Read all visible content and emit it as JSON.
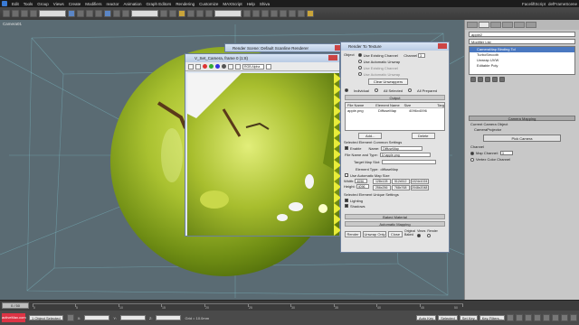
{
  "app": {
    "menu": [
      "Edit",
      "Tools",
      "Group",
      "Views",
      "Create",
      "Modifiers",
      "reactor",
      "Animation",
      "Graph Editors",
      "Rendering",
      "Customize",
      "MAXScript",
      "Help",
      "Shiva"
    ],
    "title_right": [
      "FaceliftScript",
      "defFrameScene"
    ]
  },
  "toolbar": {
    "selection_filter": "All",
    "view_dropdown": "View"
  },
  "viewport": {
    "label": "Camera01"
  },
  "command_panel": {
    "object_name": "apple2",
    "modifier_list": "Modifier List",
    "stack": [
      "CameraMap Binding Tol",
      "TurboSmooth",
      "Unwrap UVW",
      "Editable Poly"
    ],
    "selected_stack_index": 0,
    "rollout_camera_mapping": "Camera Mapping",
    "current_camera_object_label": "Current Camera Object",
    "current_camera_value": "CameraProjector",
    "pick_camera_button": "Pick Camera",
    "channel_group": "Channel",
    "map_channel_label": "Map Channel:",
    "map_channel_value": "3",
    "vertex_color_channel_label": "Vertex Color Channel"
  },
  "render_scene": {
    "title": "Render Scene: Default Scanline Renderer"
  },
  "frame_buffer": {
    "title": "V_Set_Camera, frame 0 (1:8)",
    "channel_select": "RGB Alpha",
    "swatch_colors": [
      "#d33",
      "#3a3",
      "#33d",
      "#555",
      "#ddd",
      "#fff"
    ]
  },
  "rtt": {
    "title": "Render To Texture",
    "object_label": "Object",
    "mapping_coords": [
      "Use Existing Channel",
      "Use Automatic Unwrap"
    ],
    "sub_objects": [
      "Use Existing Channel",
      "Use Automatic Unwrap"
    ],
    "channel_label": "Channel",
    "channel_value": "3",
    "clear_unwrappers": "Clear Unwrappers",
    "individual": "Individual",
    "all_selected": "All Selected",
    "all_prepared": "All Prepared",
    "output_section": "Output",
    "table_headers": [
      "File Name",
      "Element Name",
      "Size",
      "Targ"
    ],
    "table_rows": [
      [
        "apple.png",
        "DiffuseMap",
        "4096x4096",
        ""
      ]
    ],
    "add_button": "Add...",
    "delete_button": "Delete",
    "element_settings": "Selected Element Common Settings",
    "enable_label": "Enable",
    "name_label": "Name:",
    "name_value": "DiffuseMap",
    "file_name_label": "File Name and Type:",
    "file_name_value": "D:\\apple.png",
    "target_map_slot": "Target Map Slot:",
    "element_type_label": "Element Type:",
    "element_type_value": "diffuseMap",
    "auto_map_size": "Use Automatic Map Size",
    "width_label": "Width:",
    "width_value": "4096",
    "height_label": "Height:",
    "height_value": "4096",
    "sizes": [
      "128x128",
      "512x512",
      "1024x1024",
      "256x256",
      "768x768",
      "2048x2048"
    ],
    "unique_settings": "Selected Element Unique Settings",
    "lighting": "Lighting",
    "shadows": "Shadows",
    "baked_material": "Baked Material",
    "automatic_mapping": "Automatic Mapping",
    "render_button": "Render",
    "unwrap_only": "Unwrap Only",
    "close_button": "Close",
    "original_label": "Original",
    "baked_label": "Baked",
    "views_label": "Views",
    "render_label": "Render"
  },
  "timeline": {
    "slider": "0 / 50",
    "ticks": [
      "0",
      "5",
      "10",
      "15",
      "20",
      "25",
      "30",
      "35",
      "40",
      "45",
      "50"
    ]
  },
  "statusbar": {
    "maxscript": "activeMax.com",
    "selected": "1 Object Selected",
    "x_label": "X:",
    "y_label": "Y:",
    "z_label": "Z:",
    "grid": "Grid = 10.0mm",
    "autokey": "Auto Key",
    "selected_filter": "Selected",
    "set_key": "Set Key",
    "key_filters": "Key Filters..."
  }
}
